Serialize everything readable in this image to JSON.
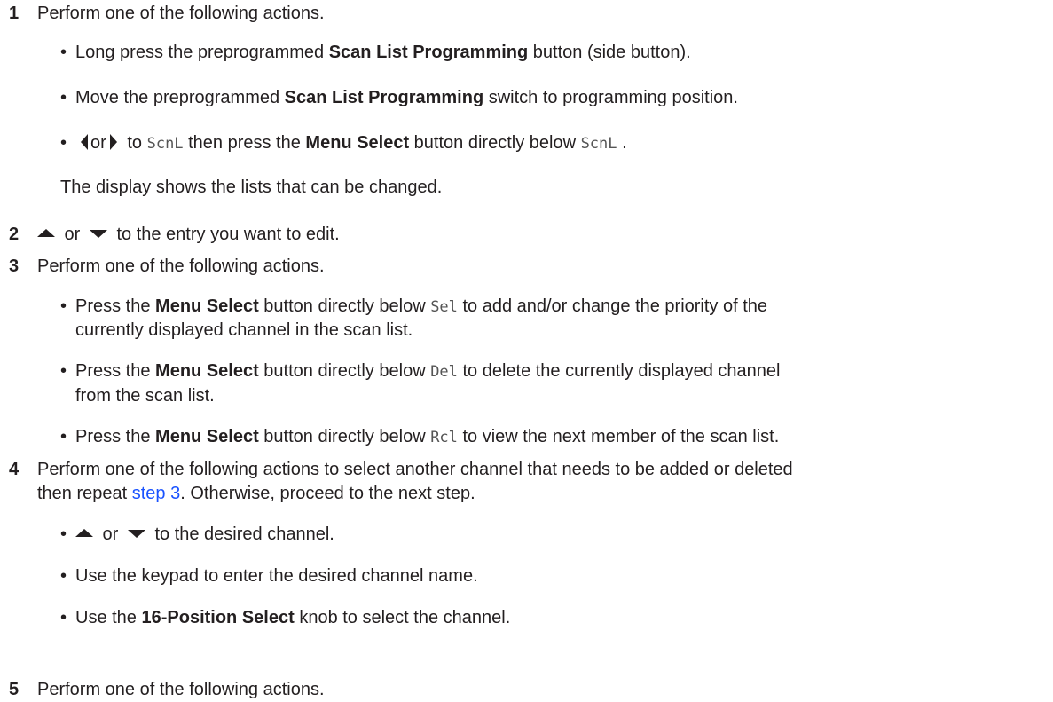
{
  "steps": [
    {
      "number": "1",
      "text": "Perform one of the following actions.",
      "bullets": [
        {
          "pre": "Long press the preprogrammed ",
          "bold": "Scan List Programming",
          "post": " button (side button)."
        },
        {
          "pre": "Move the preprogrammed ",
          "bold": "Scan List Programming",
          "post": " switch to programming position."
        },
        {
          "or": "or",
          "to_text": " to ",
          "code1": "ScnL",
          "mid": " then press the ",
          "bold": "Menu Select",
          "post": " button directly below ",
          "code2": "ScnL",
          "end": " ."
        }
      ],
      "note": "The display shows the lists that can be changed."
    },
    {
      "number": "2",
      "or": " or ",
      "text": " to the entry you want to edit."
    },
    {
      "number": "3",
      "text": "Perform one of the following actions.",
      "bullets": [
        {
          "pre": "Press the ",
          "bold": "Menu Select",
          "mid": " button directly below ",
          "code": "Sel",
          "post": " to add and/or change the priority of the",
          "cont": "currently displayed channel in the scan list."
        },
        {
          "pre": "Press the ",
          "bold": "Menu Select",
          "mid": " button directly below ",
          "code": "Del",
          "post": " to delete the currently displayed channel",
          "cont": "from the scan list."
        },
        {
          "pre": "Press the ",
          "bold": "Menu Select",
          "mid": " button directly below ",
          "code": "Rcl",
          "post": " to view the next member of the scan list."
        }
      ]
    },
    {
      "number": "4",
      "text": "Perform one of the following actions to select another channel that needs to be added or deleted",
      "cont_pre": "then repeat ",
      "link": "step 3",
      "cont_post": ". Otherwise, proceed to the next step.",
      "bullets": [
        {
          "or": " or ",
          "post": " to the desired channel."
        },
        {
          "text": "Use the keypad to enter the desired channel name."
        },
        {
          "pre": "Use the ",
          "bold": "16-Position Select",
          "post": " knob to select the channel."
        }
      ]
    },
    {
      "number": "5",
      "text": "Perform one of the following actions."
    }
  ],
  "bullet_char": "•",
  "icons": [
    "left-arrow-icon",
    "right-arrow-icon",
    "up-arrow-icon",
    "down-arrow-icon"
  ]
}
